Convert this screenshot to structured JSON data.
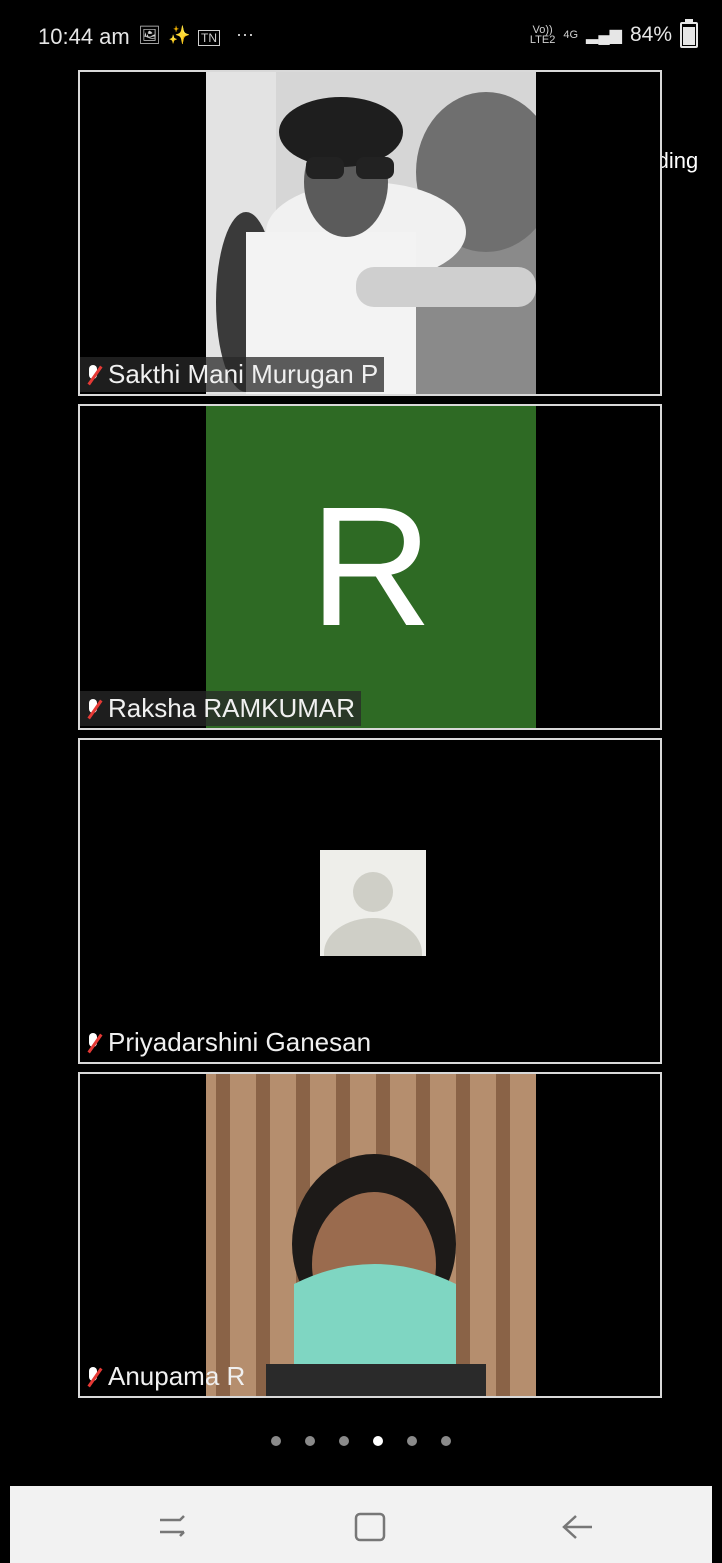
{
  "status_bar": {
    "time": "10:44 am",
    "volte": "Vo))\nLTE2",
    "network": "4G",
    "battery_percent": "84%",
    "battery_level": 0.84
  },
  "meeting": {
    "recording_label": "Recording",
    "participants": [
      {
        "name": "Sakthi Mani Murugan P",
        "muted": true,
        "view": "video"
      },
      {
        "name": "Raksha RAMKUMAR",
        "muted": true,
        "view": "initial",
        "initial": "R",
        "color": "#2e6a24"
      },
      {
        "name": "Priyadarshini Ganesan",
        "muted": true,
        "view": "placeholder"
      },
      {
        "name": "Anupama R",
        "muted": true,
        "view": "video"
      }
    ],
    "pages": 6,
    "current_page": 4
  },
  "colors": {
    "recording_dot": "#e53935",
    "muted_slash": "#e53935",
    "tile_border": "#d9d9d9"
  }
}
